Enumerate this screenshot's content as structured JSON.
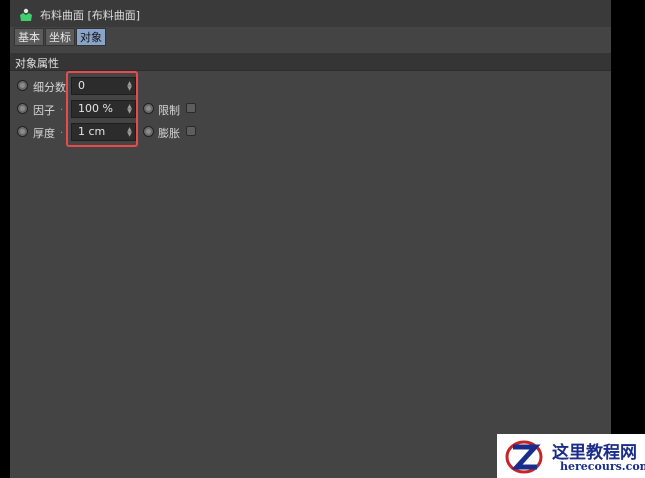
{
  "window": {
    "title": "布料曲面 [布料曲面]",
    "icon": "cloth-surface-icon"
  },
  "tabs": [
    {
      "label": "基本",
      "active": false
    },
    {
      "label": "坐标",
      "active": false
    },
    {
      "label": "对象",
      "active": true
    }
  ],
  "section": {
    "title": "对象属性"
  },
  "properties": {
    "subdivisions": {
      "label": "细分数",
      "value": "0"
    },
    "factor": {
      "label": "因子",
      "dots": ".",
      "value": "100 %"
    },
    "thickness": {
      "label": "厚度",
      "dots": ".",
      "value": "1 cm"
    },
    "limit": {
      "label": "限制",
      "checked": false
    },
    "expand": {
      "label": "膨胀",
      "checked": false
    }
  },
  "watermark": {
    "title": "这里教程网",
    "site": "herecours.com"
  },
  "colors": {
    "panel": "#444444",
    "highlight": "#e84b4b",
    "active_tab": "#8aa3c8"
  }
}
